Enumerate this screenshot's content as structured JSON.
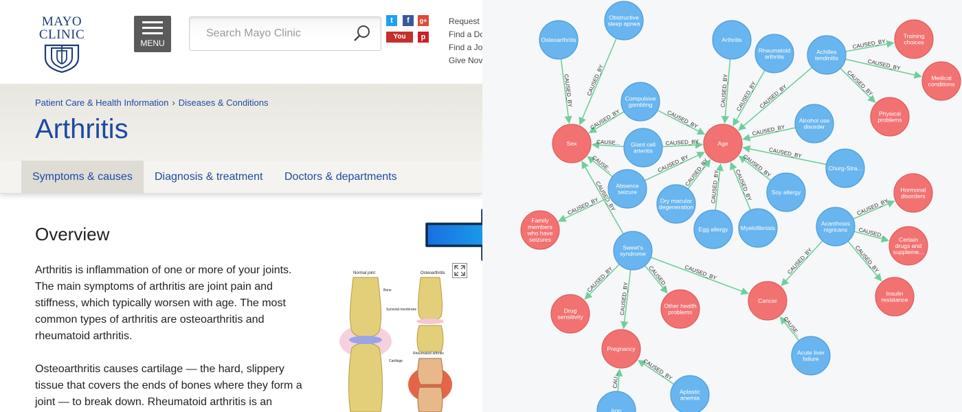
{
  "mayo": {
    "logo": {
      "line1": "MAYO",
      "line2": "CLINIC"
    },
    "menu_label": "MENU",
    "search": {
      "placeholder": "Search Mayo Clinic"
    },
    "social": [
      "twitter-icon",
      "facebook-icon",
      "google-plus-icon",
      "youtube-icon",
      "pinterest-icon"
    ],
    "top_links": [
      "Request",
      "Find a Do",
      "Find a Jo",
      "Give Nov"
    ],
    "breadcrumb": [
      "Patient Care & Health Information",
      "Diseases & Conditions"
    ],
    "title": "Arthritis",
    "tabs": [
      "Symptoms & causes",
      "Diagnosis & treatment",
      "Doctors & departments"
    ],
    "overview_heading": "Overview",
    "para1": [
      "Arthritis is inflammation of one or more of your joints.",
      "The main symptoms of arthritis are joint pain and",
      "stiffness, which typically worsen with age. The most",
      "common types of arthritis are osteoarthritis and",
      "rheumatoid arthritis."
    ],
    "para2": [
      "Osteoarthritis causes cartilage — the hard, slippery",
      "tissue that covers the ends of bones where they form a",
      "joint — to break down. Rheumatoid arthritis is an"
    ],
    "figure_labels": {
      "normal": "Normal joint",
      "osteo": "Osteoarthritis",
      "bone": "Bone",
      "synovial": "Synovial membrane",
      "cartilage": "Cartilage",
      "rheum": "Rheumatoid arthritis"
    },
    "colors": {
      "accent": "#1f4aa0",
      "youtube": "#c4302b",
      "twitter": "#1da1f2",
      "facebook": "#3b5998",
      "gplus": "#dd4b39",
      "pinterest": "#cb2027"
    }
  },
  "graph": {
    "colors": {
      "cause": "#68b5ef",
      "target": "#f27272",
      "edge": "#6fcf9c"
    },
    "nodes": [
      {
        "id": "osteo",
        "label": [
          "Osteoarthritis"
        ],
        "type": "cause"
      },
      {
        "id": "apnea",
        "label": [
          "Obstructive",
          "sleep apnea"
        ],
        "type": "cause"
      },
      {
        "id": "arth",
        "label": [
          "Arthritis"
        ],
        "type": "cause"
      },
      {
        "id": "rheum",
        "label": [
          "Rheumatoid",
          "arthritis"
        ],
        "type": "cause"
      },
      {
        "id": "achil",
        "label": [
          "Achilles",
          "tendinitis"
        ],
        "type": "cause"
      },
      {
        "id": "train",
        "label": [
          "Training",
          "choices"
        ],
        "type": "target"
      },
      {
        "id": "medc",
        "label": [
          "Medical",
          "conditions"
        ],
        "type": "target"
      },
      {
        "id": "phys",
        "label": [
          "Physical",
          "problems"
        ],
        "type": "target"
      },
      {
        "id": "compg",
        "label": [
          "Compulsive",
          "gambling"
        ],
        "type": "cause"
      },
      {
        "id": "alc",
        "label": [
          "Alcohol use",
          "disorder"
        ],
        "type": "cause"
      },
      {
        "id": "sex",
        "label": [
          "Sex"
        ],
        "type": "target"
      },
      {
        "id": "giant",
        "label": [
          "Giant cell",
          "arteritis"
        ],
        "type": "cause"
      },
      {
        "id": "age",
        "label": [
          "Age"
        ],
        "type": "target"
      },
      {
        "id": "churg",
        "label": [
          "Churg-Stra..."
        ],
        "type": "cause"
      },
      {
        "id": "absz",
        "label": [
          "Absence",
          "seizure"
        ],
        "type": "cause"
      },
      {
        "id": "soy",
        "label": [
          "Soy allergy"
        ],
        "type": "cause"
      },
      {
        "id": "hormd",
        "label": [
          "Hormonal",
          "disorders"
        ],
        "type": "target"
      },
      {
        "id": "dmd",
        "label": [
          "Dry macular",
          "degeneration"
        ],
        "type": "cause"
      },
      {
        "id": "fam",
        "label": [
          "Family",
          "members",
          "who have",
          "seizures"
        ],
        "type": "target"
      },
      {
        "id": "egg",
        "label": [
          "Egg allergy"
        ],
        "type": "cause"
      },
      {
        "id": "myelo",
        "label": [
          "Myelofibrosis"
        ],
        "type": "cause"
      },
      {
        "id": "acan",
        "label": [
          "Acanthosis",
          "nigricans"
        ],
        "type": "cause"
      },
      {
        "id": "certd",
        "label": [
          "Certain",
          "drugs and",
          "suppleme..."
        ],
        "type": "target"
      },
      {
        "id": "sweet",
        "label": [
          "Sweet's",
          "syndrome"
        ],
        "type": "cause"
      },
      {
        "id": "insr",
        "label": [
          "Insulin",
          "resistance"
        ],
        "type": "target"
      },
      {
        "id": "drugs",
        "label": [
          "Drug",
          "sensitivity"
        ],
        "type": "target"
      },
      {
        "id": "othp",
        "label": [
          "Other health",
          "problems"
        ],
        "type": "target"
      },
      {
        "id": "cancer",
        "label": [
          "Cancer"
        ],
        "type": "target"
      },
      {
        "id": "preg",
        "label": [
          "Pregnancy"
        ],
        "type": "target"
      },
      {
        "id": "alf",
        "label": [
          "Acute liver",
          "failure"
        ],
        "type": "cause"
      },
      {
        "id": "aplan",
        "label": [
          "Aplastic",
          "anemia"
        ],
        "type": "cause"
      },
      {
        "id": "iron",
        "label": [
          "Iron"
        ],
        "type": "cause"
      }
    ],
    "edges": [
      {
        "from": "osteo",
        "to": "sex",
        "label": "CAUSED_BY"
      },
      {
        "from": "apnea",
        "to": "sex",
        "label": "CAUSED_BY"
      },
      {
        "from": "compg",
        "to": "sex",
        "label": "CAUSED_BY"
      },
      {
        "from": "giant",
        "to": "sex",
        "label": "CAUSE..."
      },
      {
        "from": "absz",
        "to": "sex",
        "label": "CAUSE..."
      },
      {
        "from": "sweet",
        "to": "sex",
        "label": "CAUSED_BY"
      },
      {
        "from": "arth",
        "to": "age",
        "label": "CAUSED_BY"
      },
      {
        "from": "rheum",
        "to": "age",
        "label": "CAUSED_BY"
      },
      {
        "from": "achil",
        "to": "age",
        "label": "CAUSED_BY"
      },
      {
        "from": "compg",
        "to": "age",
        "label": "CAUSED_BY"
      },
      {
        "from": "giant",
        "to": "age",
        "label": "CAUSED_BY"
      },
      {
        "from": "alc",
        "to": "age",
        "label": "CAUSED_BY"
      },
      {
        "from": "churg",
        "to": "age",
        "label": "CAUSED_BY"
      },
      {
        "from": "absz",
        "to": "age",
        "label": "CAUSED_BY"
      },
      {
        "from": "dmd",
        "to": "age",
        "label": "CAUSED_BY"
      },
      {
        "from": "soy",
        "to": "age",
        "label": "CAUSED_BY"
      },
      {
        "from": "egg",
        "to": "age",
        "label": "CAUSED_BY"
      },
      {
        "from": "myelo",
        "to": "age",
        "label": "CAUSED_BY"
      },
      {
        "from": "achil",
        "to": "train",
        "label": "CAUSED_BY"
      },
      {
        "from": "achil",
        "to": "medc",
        "label": "CAUSED_BY"
      },
      {
        "from": "achil",
        "to": "phys",
        "label": "CAUSED_BY"
      },
      {
        "from": "absz",
        "to": "fam",
        "label": "CAUSED_BY"
      },
      {
        "from": "acan",
        "to": "hormd",
        "label": "CAUSED_BY"
      },
      {
        "from": "acan",
        "to": "certd",
        "label": "CAUSED..."
      },
      {
        "from": "acan",
        "to": "insr",
        "label": "CAUSED_BY"
      },
      {
        "from": "acan",
        "to": "cancer",
        "label": "CAUSED_BY"
      },
      {
        "from": "sweet",
        "to": "drugs",
        "label": "CAUSED_BY"
      },
      {
        "from": "sweet",
        "to": "othp",
        "label": "CAUSED..."
      },
      {
        "from": "sweet",
        "to": "cancer",
        "label": "CAUSED_BY"
      },
      {
        "from": "sweet",
        "to": "preg",
        "label": "CAUSED_BY"
      },
      {
        "from": "alf",
        "to": "cancer",
        "label": "CAUSE..."
      },
      {
        "from": "aplan",
        "to": "preg",
        "label": "CAUSED_BY"
      },
      {
        "from": "iron",
        "to": "preg",
        "label": "CAU..."
      }
    ]
  }
}
